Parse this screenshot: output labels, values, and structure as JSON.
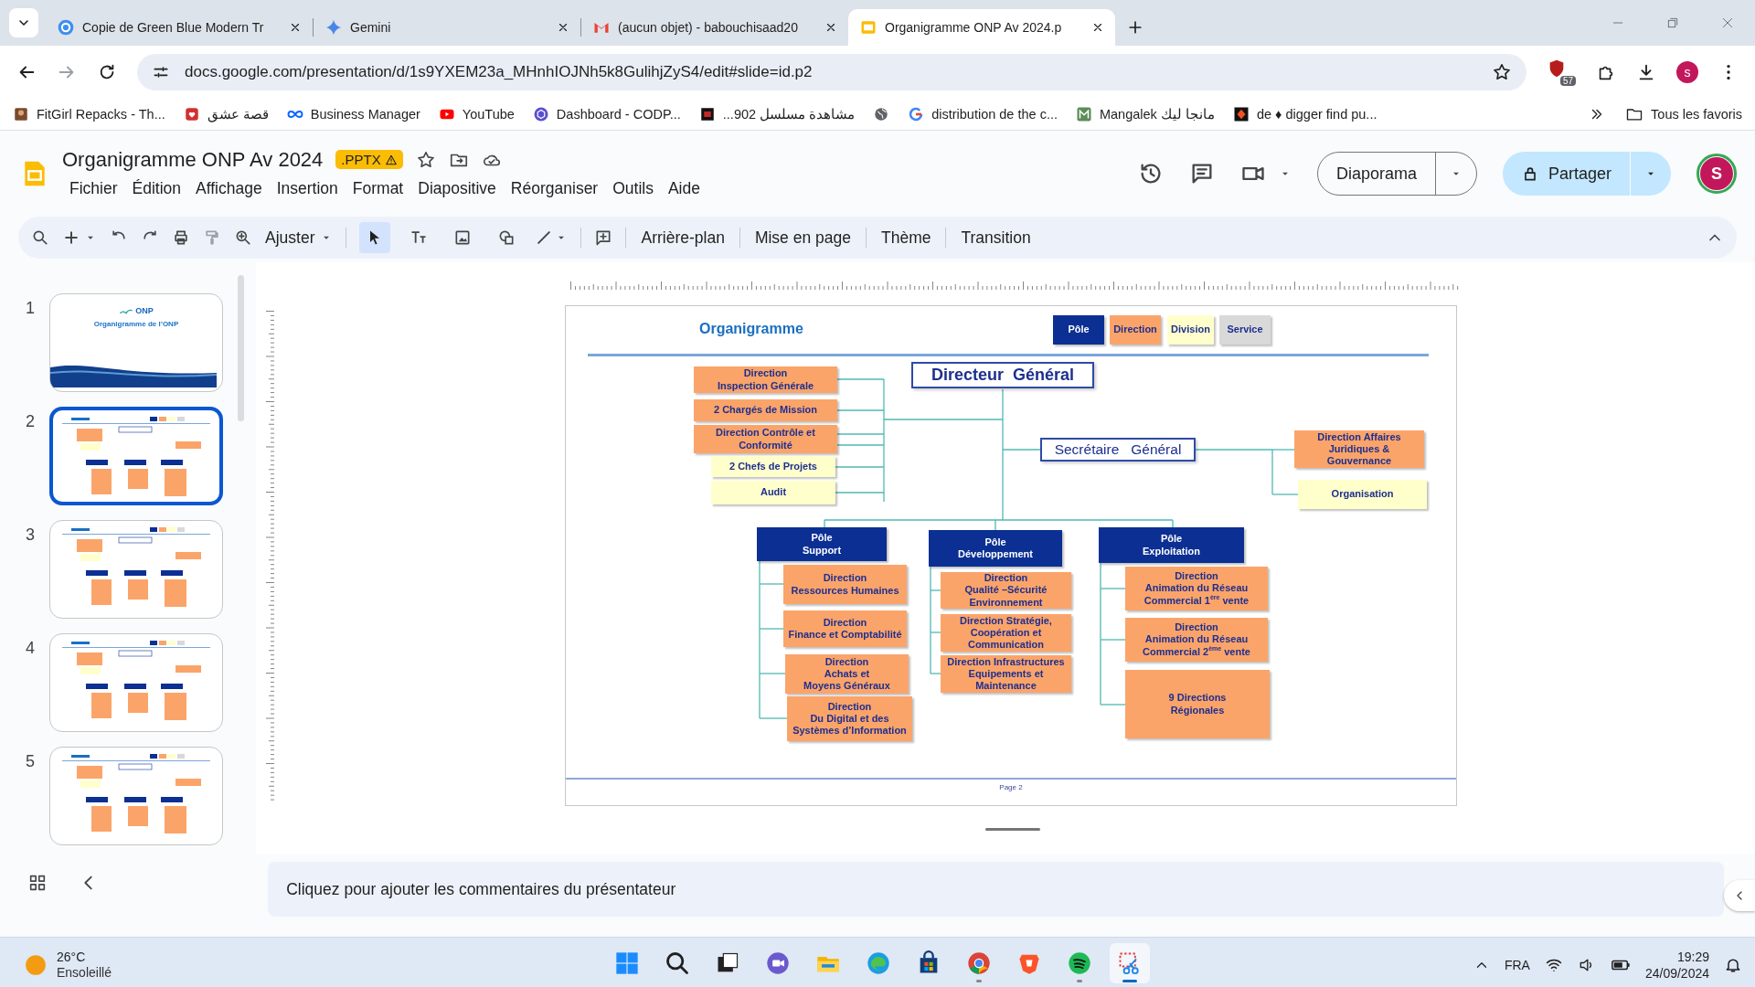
{
  "browser": {
    "tabs": [
      {
        "title": "Copie de Green Blue Modern Tr",
        "kind": "circle",
        "selected": false
      },
      {
        "title": "Gemini",
        "kind": "sparkle",
        "selected": false
      },
      {
        "title": "(aucun objet) - babouchisaad20",
        "kind": "mail",
        "selected": false
      },
      {
        "title": "Organigramme ONP Av 2024.p",
        "kind": "slides",
        "selected": true
      }
    ],
    "url": "docs.google.com/presentation/d/1s9YXEM23a_MHnhIOJNh5k8GulihjZyS4/edit#slide=id.p2",
    "extension_badge": "57",
    "profile": "s",
    "bookmarks": [
      {
        "label": "FitGirl Repacks - Th...",
        "kind": "photo"
      },
      {
        "label": "قصة عشق",
        "kind": "heart"
      },
      {
        "label": "Business Manager",
        "kind": "infinity"
      },
      {
        "label": "YouTube",
        "kind": "play"
      },
      {
        "label": "Dashboard - CODP...",
        "kind": "hexagon"
      },
      {
        "label": "مشاهدة مسلسل 902...",
        "kind": "dark"
      },
      {
        "kind": "globe"
      },
      {
        "label": "distribution de the c...",
        "kind": "ring"
      },
      {
        "label": "Mangalek مانجا ليك",
        "kind": "m"
      },
      {
        "label": "de ♦ digger find pu...",
        "kind": "diamond"
      }
    ],
    "all_bookmarks": "Tous les favoris"
  },
  "docs": {
    "title": "Organigramme ONP Av 2024",
    "badge": ".PPTX",
    "menus": [
      "Fichier",
      "Édition",
      "Affichage",
      "Insertion",
      "Format",
      "Diapositive",
      "Réorganiser",
      "Outils",
      "Aide"
    ],
    "slideshow_button": "Diaporama",
    "share_button": "Partager",
    "avatar": "S",
    "zoom_label": "Ajuster",
    "tools": [
      {
        "kind": "select",
        "selected": true
      },
      {
        "kind": "text",
        "selected": false
      },
      {
        "kind": "image",
        "selected": false
      },
      {
        "kind": "shape",
        "selected": false
      }
    ],
    "actions": [
      "Arrière-plan",
      "Mise en page",
      "Thème",
      "Transition"
    ]
  },
  "slides": [
    {
      "number": "1",
      "kind": "title",
      "caption": "Organigramme de l’ONP",
      "logo": "ONP",
      "selected": false
    },
    {
      "number": "2",
      "kind": "org",
      "selected": true
    },
    {
      "number": "3",
      "kind": "org",
      "selected": false
    },
    {
      "number": "4",
      "kind": "org",
      "selected": false
    },
    {
      "number": "5",
      "kind": "org",
      "selected": false
    }
  ],
  "slide": {
    "title": "Organigramme",
    "legend": [
      {
        "label": "Pôle",
        "kind": "pole"
      },
      {
        "label": "Direction",
        "kind": "direction"
      },
      {
        "label": "Division",
        "kind": "division"
      },
      {
        "label": "Service",
        "kind": "service"
      }
    ],
    "director": "Directeur  Général",
    "secretary": "Secrétaire   Général",
    "left_units": [
      {
        "label": "Direction\nInspection Générale",
        "kind": "direction"
      },
      {
        "label": "2 Chargés de Mission",
        "kind": "direction"
      },
      {
        "label": "Direction Contrôle et\nConformité",
        "kind": "direction"
      },
      {
        "label": "2 Chefs de Projets",
        "kind": "division"
      },
      {
        "label": "Audit",
        "kind": "division"
      }
    ],
    "right_units": [
      {
        "label": "Direction Affaires\nJuridiques &\nGouvernance",
        "kind": "direction"
      },
      {
        "label": "Organisation",
        "kind": "division"
      }
    ],
    "poles": [
      {
        "label": "Pôle\nSupport",
        "children": [
          {
            "label": "Direction\nRessources Humaines",
            "kind": "direction"
          },
          {
            "label": "Direction\nFinance et Comptabilité",
            "kind": "direction"
          },
          {
            "label": "Direction\nAchats et\nMoyens Généraux",
            "kind": "direction"
          },
          {
            "label": "Direction\nDu Digital et des\nSystèmes d’Information",
            "kind": "direction"
          }
        ]
      },
      {
        "label": "Pôle\nDéveloppement",
        "children": [
          {
            "label": "Direction\nQualité –Sécurité\nEnvironnement",
            "kind": "direction"
          },
          {
            "label": "Direction Stratégie,\nCoopération et\nCommunication",
            "kind": "direction"
          },
          {
            "label": "Direction Infrastructures\nEquipements et\nMaintenance",
            "kind": "direction"
          }
        ]
      },
      {
        "label": "Pôle\nExploitation",
        "children": [
          {
            "label": "Direction\nAnimation du Réseau\nCommercial 1$^{ère}$ vente",
            "kind": "direction"
          },
          {
            "label": "Direction\nAnimation du Réseau\nCommercial 2$^{ème}$ vente",
            "kind": "direction"
          },
          {
            "label": "9 Directions\nRégionales",
            "kind": "direction"
          }
        ]
      }
    ],
    "footer": "Page 2"
  },
  "notes": {
    "placeholder": "Cliquez pour ajouter les commentaires du présentateur"
  },
  "taskbar": {
    "temperature": "26°C",
    "weather": "Ensoleillé",
    "language": "FRA",
    "time": "19:29",
    "date": "24/09/2024",
    "apps": [
      {
        "kind": "start",
        "running": false,
        "selected": false
      },
      {
        "kind": "search",
        "running": false,
        "selected": false
      },
      {
        "kind": "files",
        "running": false,
        "selected": false
      },
      {
        "kind": "chat",
        "running": false,
        "selected": false
      },
      {
        "kind": "folder",
        "running": false,
        "selected": false
      },
      {
        "kind": "edge",
        "running": false,
        "selected": false
      },
      {
        "kind": "store",
        "running": false,
        "selected": false
      },
      {
        "kind": "chrome",
        "running": true,
        "selected": false
      },
      {
        "kind": "brave",
        "running": false,
        "selected": false
      },
      {
        "kind": "spotify",
        "running": true,
        "selected": false
      },
      {
        "kind": "snip",
        "running": true,
        "selected": true
      }
    ]
  }
}
